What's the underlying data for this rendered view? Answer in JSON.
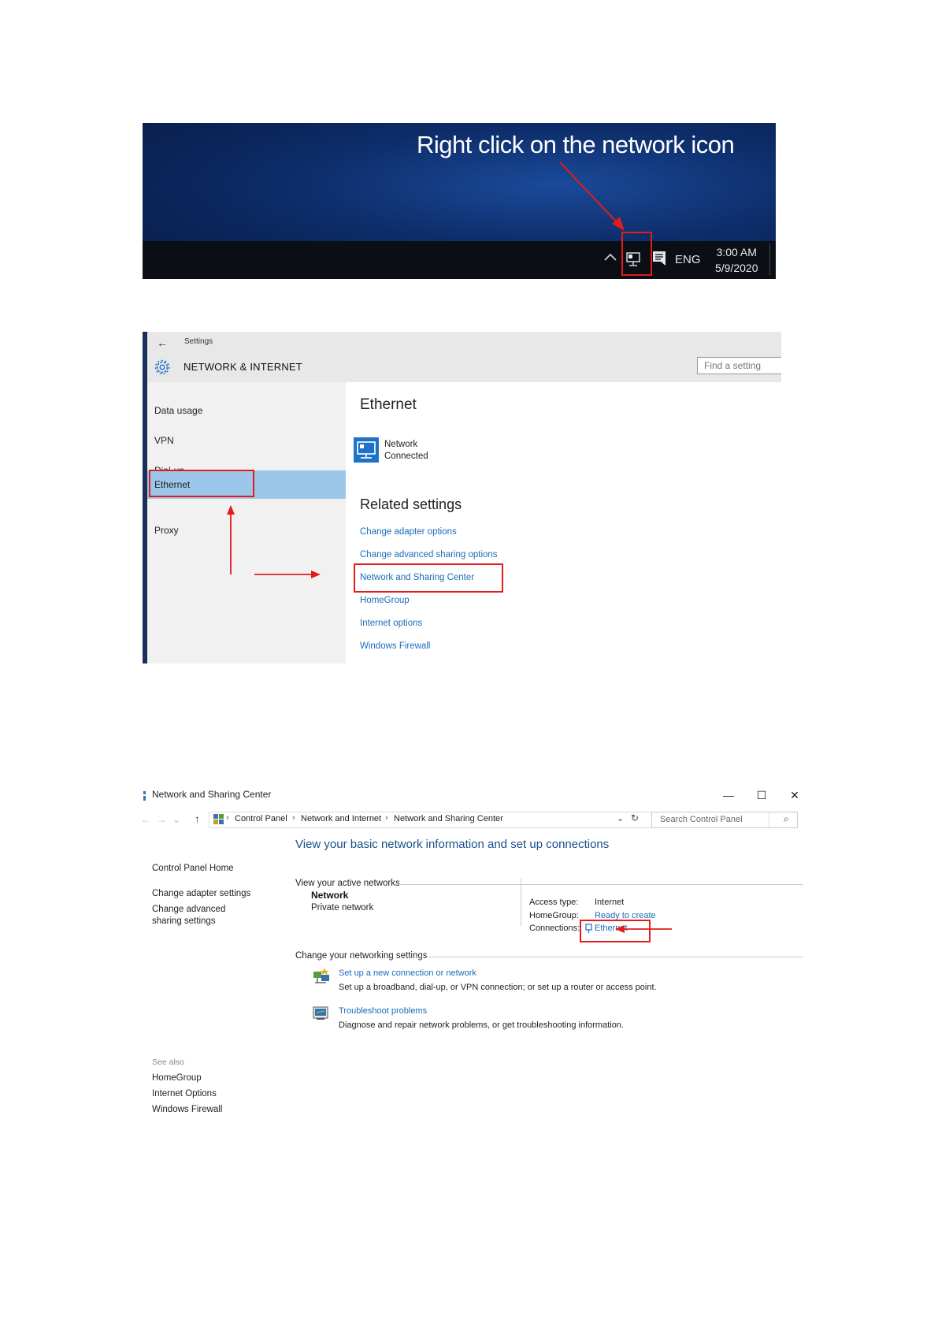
{
  "panel1": {
    "caption": "Right click on the network icon",
    "tray": {
      "language": "ENG",
      "time": "3:00 AM",
      "date": "5/9/2020"
    }
  },
  "panel2": {
    "header": {
      "back_label": "Settings",
      "section_title": "NETWORK & INTERNET",
      "search_placeholder": "Find a setting"
    },
    "nav": [
      "Data usage",
      "VPN",
      "Dial-up",
      "Ethernet",
      "Proxy"
    ],
    "selected_nav": "Ethernet",
    "ethernet_heading": "Ethernet",
    "network": {
      "name": "Network",
      "status": "Connected"
    },
    "related_heading": "Related settings",
    "related_links": [
      "Change adapter options",
      "Change advanced sharing options",
      "Network and Sharing Center",
      "HomeGroup",
      "Internet options",
      "Windows Firewall"
    ],
    "colors": {
      "selected": "#9cc7ea",
      "link": "#1a6cb8",
      "highlight": "#e31b1b"
    }
  },
  "panel3": {
    "window_title": "Network and Sharing Center",
    "controls": [
      "—",
      "☐",
      "✕"
    ],
    "breadcrumb": [
      "Control Panel",
      "Network and Internet",
      "Network and Sharing Center"
    ],
    "search_placeholder": "Search Control Panel",
    "sidebar": {
      "home": "Control Panel Home",
      "links": [
        "Change adapter settings",
        "Change advanced sharing settings"
      ],
      "see_also_label": "See also",
      "see_also": [
        "HomeGroup",
        "Internet Options",
        "Windows Firewall"
      ]
    },
    "main_heading": "View your basic network information and set up connections",
    "active_networks_label": "View your active networks",
    "network": {
      "name": "Network",
      "type": "Private network"
    },
    "details": {
      "access_type_label": "Access type:",
      "access_type": "Internet",
      "homegroup_label": "HomeGroup:",
      "homegroup": "Ready to create",
      "connections_label": "Connections:",
      "connections": "Ethernet"
    },
    "change_settings_label": "Change your networking settings",
    "tasks": [
      {
        "title": "Set up a new connection or network",
        "desc": "Set up a broadband, dial-up, or VPN connection; or set up a router or access point."
      },
      {
        "title": "Troubleshoot problems",
        "desc": "Diagnose and repair network problems, or get troubleshooting information."
      }
    ]
  }
}
